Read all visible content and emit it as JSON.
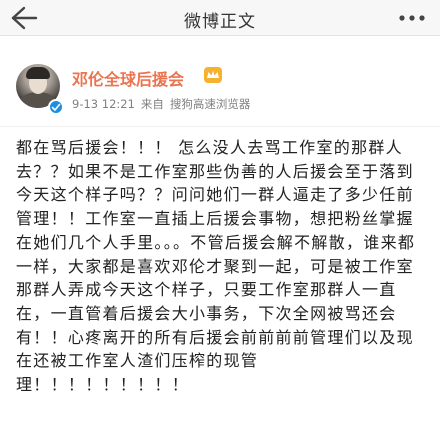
{
  "nav": {
    "title": "微博正文"
  },
  "post": {
    "username": "邓伦全球后援会",
    "time": "9-13 12:21",
    "source_prefix": "来自",
    "source": "搜狗高速浏览器",
    "text": "都在骂后援会！！！ 怎么没人去骂工作室的那群人去？？如果不是工作室那些伪善的人后援会至于落到今天这个样子吗？？问问她们一群人逼走了多少任前管理！！工作室一直插上后援会事物，想把粉丝掌握在她们几个人手里。。。不管后援会解不解散，谁来都一样，大家都是喜欢邓伦才聚到一起，可是被工作室那群人弄成今天这个样子，只要工作室那群人一直在，一直管着后援会大小事务，下次全网被骂还会有！！心疼离开的所有后援会前前前前管理们以及现在还被工作室人渣们压榨的现管理！！！！！！！！！"
  },
  "colors": {
    "username": "#eb7350",
    "verified": "#1d8fe1",
    "navbar_bg": "#f7f7f7"
  },
  "icons": {
    "back": "back-arrow-icon",
    "more": "more-dots-icon",
    "verified": "verified-check-icon",
    "vip": "vip-crown-icon"
  }
}
